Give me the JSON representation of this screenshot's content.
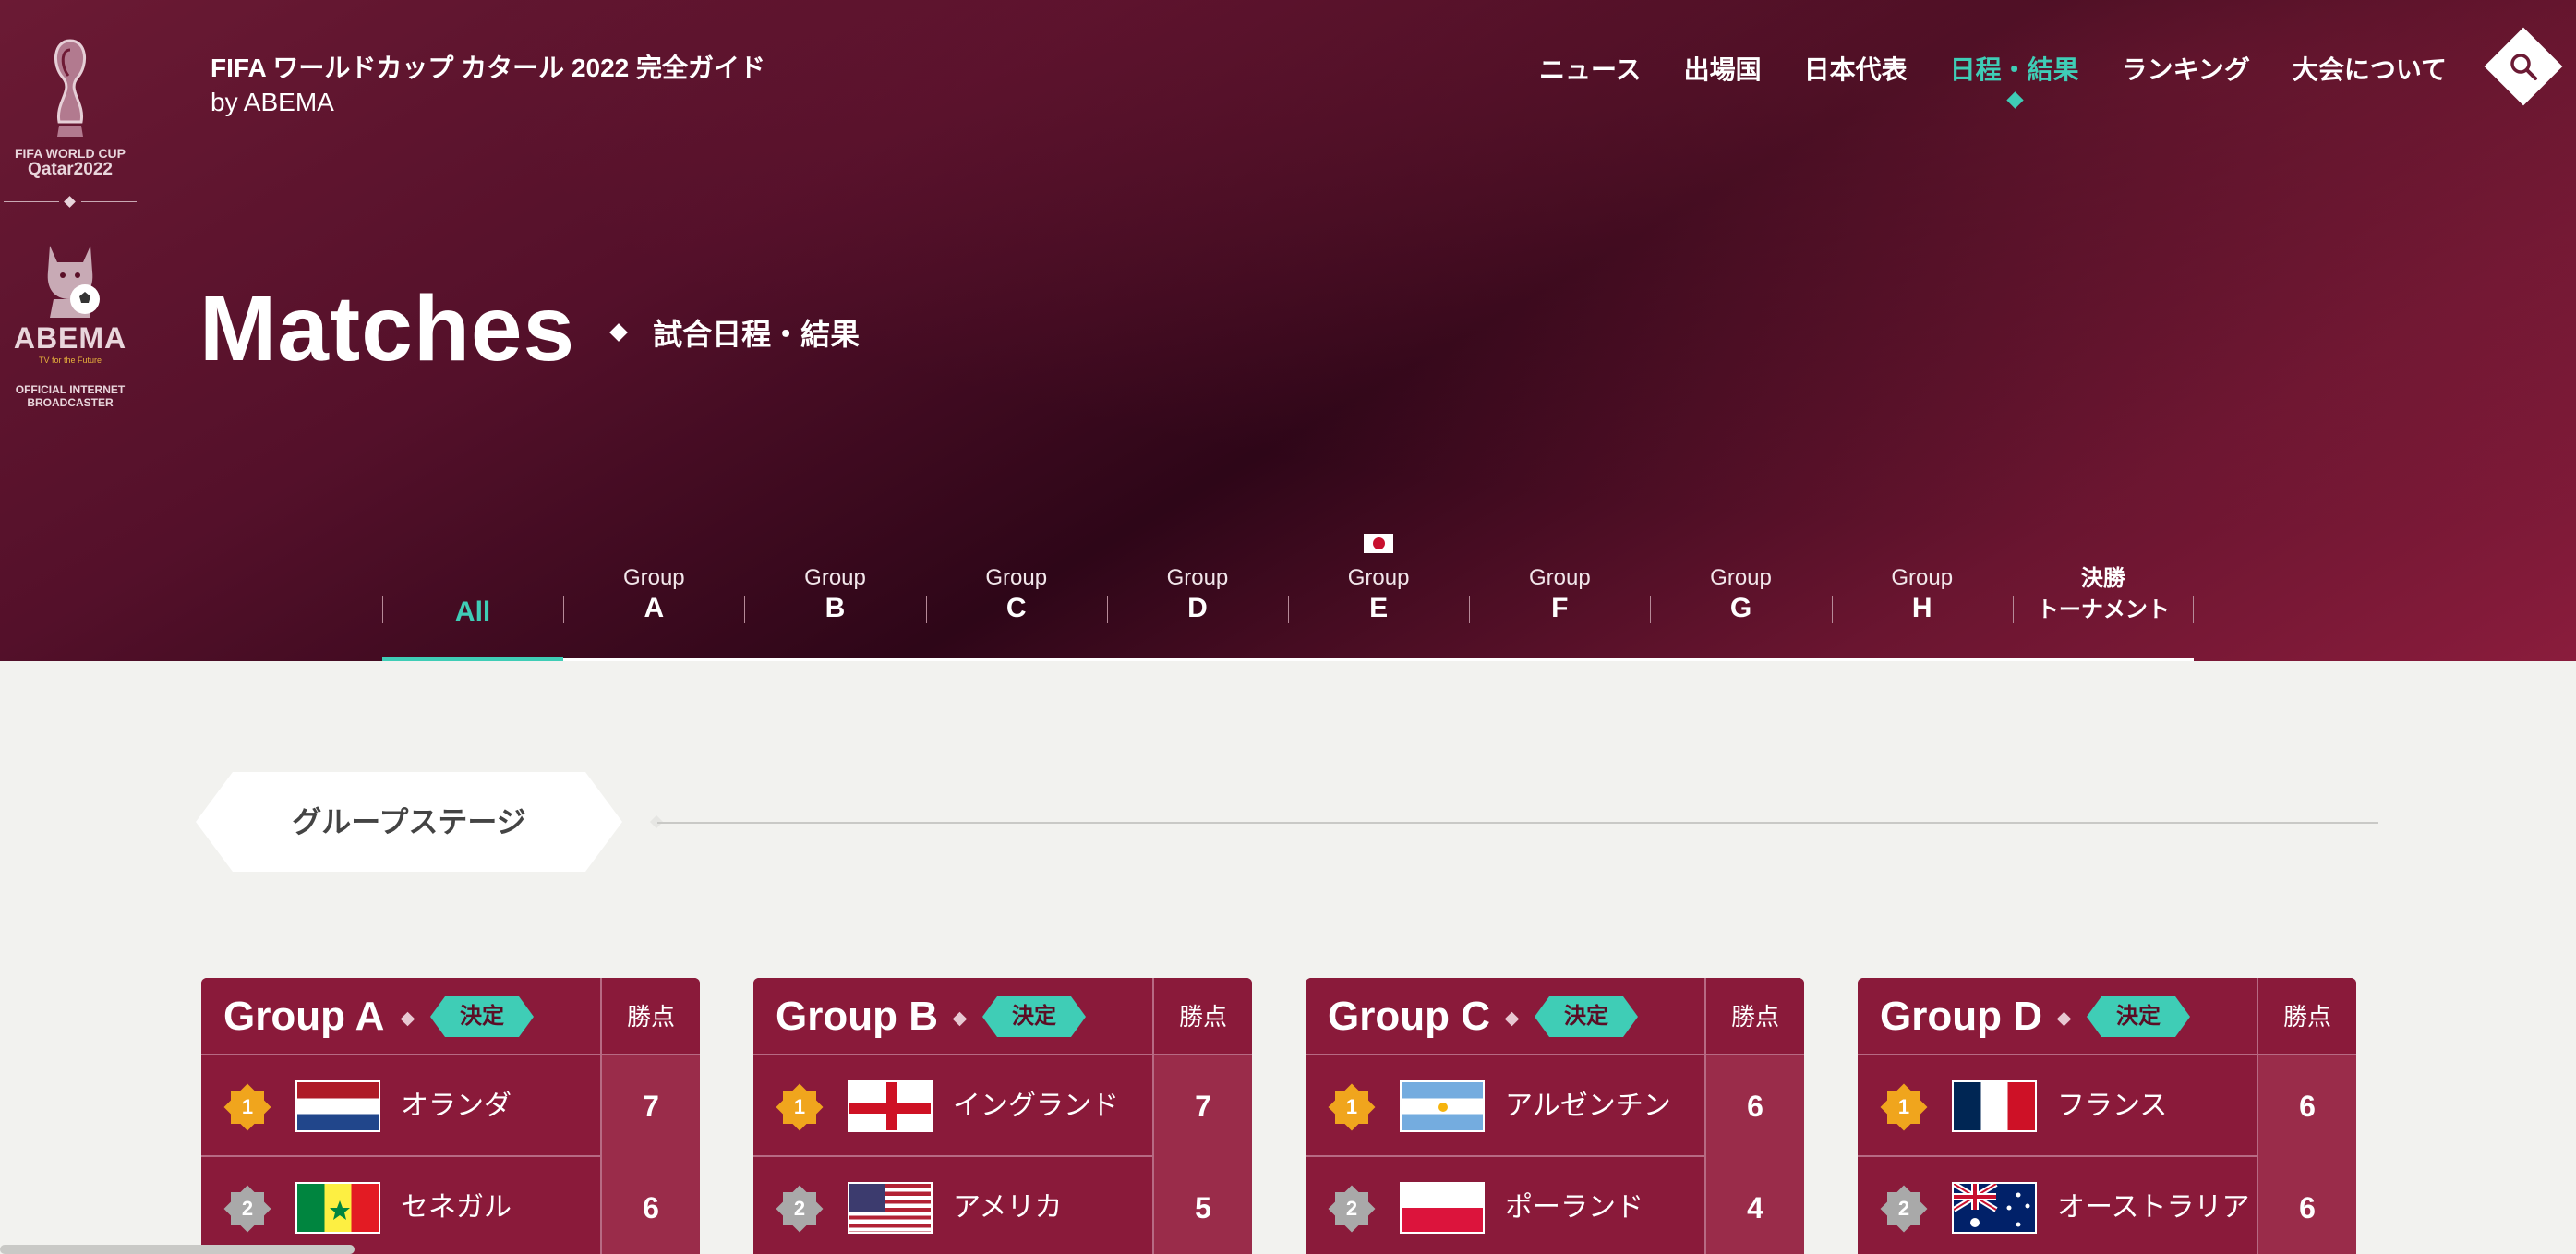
{
  "logo": {
    "worldcup_line1": "FIFA WORLD CUP",
    "worldcup_line2": "Qatar2022",
    "abema_name": "ABEMA",
    "abema_tagline": "TV for the Future",
    "official_line1": "OFFICIAL INTERNET",
    "official_line2": "BROADCASTER"
  },
  "site_title": {
    "line1": "FIFA ワールドカップ カタール 2022 完全ガイド",
    "line2": "by ABEMA"
  },
  "nav": [
    {
      "label": "ニュース",
      "active": false
    },
    {
      "label": "出場国",
      "active": false
    },
    {
      "label": "日本代表",
      "active": false
    },
    {
      "label": "日程・結果",
      "active": true
    },
    {
      "label": "ランキング",
      "active": false
    },
    {
      "label": "大会について",
      "active": false
    }
  ],
  "search_icon": "search-icon",
  "heading": {
    "title": "Matches",
    "subtitle": "試合日程・結果"
  },
  "tabs": [
    {
      "small": "",
      "big": "All",
      "active": true
    },
    {
      "small": "Group",
      "big": "A"
    },
    {
      "small": "Group",
      "big": "B"
    },
    {
      "small": "Group",
      "big": "C"
    },
    {
      "small": "Group",
      "big": "D"
    },
    {
      "small": "Group",
      "big": "E",
      "flag": "japan-flag"
    },
    {
      "small": "Group",
      "big": "F"
    },
    {
      "small": "Group",
      "big": "G"
    },
    {
      "small": "Group",
      "big": "H"
    },
    {
      "line1": "決勝",
      "line2": "トーナメント"
    }
  ],
  "stage_label": "グループステージ",
  "groups": [
    {
      "title": "Group A",
      "badge": "決定",
      "points_header": "勝点",
      "rows": [
        {
          "rank": "1",
          "flag": "netherlands",
          "country": "オランダ",
          "points": "7"
        },
        {
          "rank": "2",
          "flag": "senegal",
          "country": "セネガル",
          "points": "6"
        }
      ]
    },
    {
      "title": "Group B",
      "badge": "決定",
      "points_header": "勝点",
      "rows": [
        {
          "rank": "1",
          "flag": "england",
          "country": "イングランド",
          "points": "7"
        },
        {
          "rank": "2",
          "flag": "usa",
          "country": "アメリカ",
          "points": "5"
        }
      ]
    },
    {
      "title": "Group C",
      "badge": "決定",
      "points_header": "勝点",
      "rows": [
        {
          "rank": "1",
          "flag": "argentina",
          "country": "アルゼンチン",
          "points": "6"
        },
        {
          "rank": "2",
          "flag": "poland",
          "country": "ポーランド",
          "points": "4"
        }
      ]
    },
    {
      "title": "Group D",
      "badge": "決定",
      "points_header": "勝点",
      "rows": [
        {
          "rank": "1",
          "flag": "france",
          "country": "フランス",
          "points": "6"
        },
        {
          "rank": "2",
          "flag": "australia",
          "country": "オーストラリア",
          "points": "6"
        }
      ]
    }
  ],
  "colors": {
    "accent": "#3fcdb6",
    "card": "#8a1a3a",
    "gold": "#f0a51d",
    "silver": "#a9a9a9"
  }
}
